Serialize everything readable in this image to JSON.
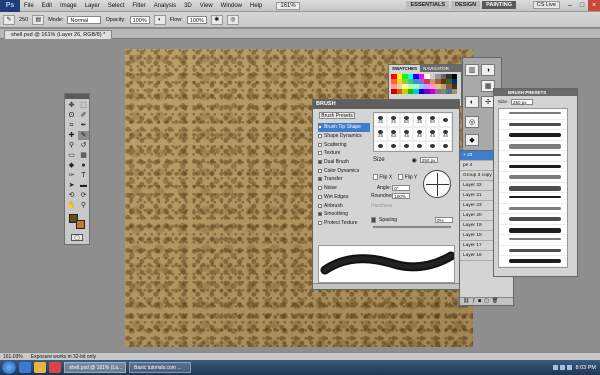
{
  "menubar": {
    "items": [
      "File",
      "Edit",
      "Image",
      "Layer",
      "Select",
      "Filter",
      "Analysis",
      "3D",
      "View",
      "Window",
      "Help"
    ],
    "zoom": "161%",
    "workspaces": [
      "ESSENTIALS",
      "DESIGN",
      "PAINTING"
    ],
    "active_workspace": "PAINTING",
    "cs_live": "CS Live"
  },
  "options": {
    "brush_size": "250",
    "mode_label": "Mode:",
    "mode_value": "Normal",
    "opacity_label": "Opacity:",
    "opacity_value": "100%",
    "flow_label": "Flow:",
    "flow_value": "100%"
  },
  "document": {
    "tab_label": "shell.psd @ 161% (Layer 26, RGB/8) *"
  },
  "brush_panel": {
    "title": "BRUSH",
    "presets_button": "Brush Presets",
    "options": [
      {
        "label": "Brush Tip Shape",
        "checked": false,
        "selected": true
      },
      {
        "label": "Shape Dynamics",
        "checked": false,
        "selected": false
      },
      {
        "label": "Scattering",
        "checked": false,
        "selected": false
      },
      {
        "label": "Texture",
        "checked": false,
        "selected": false
      },
      {
        "label": "Dual Brush",
        "checked": true,
        "selected": false
      },
      {
        "label": "Color Dynamics",
        "checked": false,
        "selected": false
      },
      {
        "label": "Transfer",
        "checked": true,
        "selected": false
      },
      {
        "label": "Noise",
        "checked": false,
        "selected": false
      },
      {
        "label": "Wet Edges",
        "checked": false,
        "selected": false
      },
      {
        "label": "Airbrush",
        "checked": false,
        "selected": false
      },
      {
        "label": "Smoothing",
        "checked": true,
        "selected": false
      },
      {
        "label": "Protect Texture",
        "checked": false,
        "selected": false
      }
    ],
    "tips": [
      "25",
      "25",
      "50",
      "25",
      "50",
      "",
      "25",
      "63",
      "45",
      "45",
      "45",
      "45",
      "",
      "",
      "",
      "",
      "",
      ""
    ],
    "size_label": "Size",
    "size_value": "250 px",
    "flip_x": "Flip X",
    "flip_y": "Flip Y",
    "angle_label": "Angle:",
    "angle_value": "0°",
    "roundness_label": "Roundness:",
    "roundness_value": "100%",
    "hardness_label": "Hardness",
    "spacing_label": "Spacing",
    "spacing_value": "0%"
  },
  "swatches": {
    "tabs": [
      "SWATCHES",
      "NAVIGATOR"
    ],
    "layers_label": "LAYERS",
    "colors": [
      "#ff0000",
      "#ffff00",
      "#00ff00",
      "#00ffff",
      "#0000ff",
      "#ff00ff",
      "#ffffff",
      "#cccccc",
      "#999999",
      "#666666",
      "#333333",
      "#000000",
      "#ff6633",
      "#ffcc33",
      "#99cc33",
      "#33cc99",
      "#3399cc",
      "#9966cc",
      "#cc3366",
      "#cc9966",
      "#996633",
      "#663300",
      "#336633",
      "#003366",
      "#ff9999",
      "#ffcc99",
      "#ffff99",
      "#ccff99",
      "#99ffcc",
      "#99ccff",
      "#cc99ff",
      "#ff99cc",
      "#e0c090",
      "#c0a070",
      "#806040",
      "#403020",
      "#cc0000",
      "#cc6600",
      "#cccc00",
      "#00cc00",
      "#00cccc",
      "#0000cc",
      "#6600cc",
      "#cc00cc",
      "#996699",
      "#669966",
      "#666699",
      "#999966"
    ]
  },
  "presets_panel": {
    "title": "BRUSH PRESETS",
    "size_label": "Size:",
    "size_value": "250 px"
  },
  "layers": {
    "rows": [
      "+ 24",
      "pe 4",
      "Group 3 copy",
      "Layer 22",
      "Layer 21",
      "Layer 23",
      "Layer 20",
      "Layer 19",
      "Layer 18",
      "Layer 17",
      "Layer 16"
    ],
    "selected_index": 0
  },
  "status": {
    "zoom": "161.03%",
    "message": "Exposure works in 32-bit only"
  },
  "taskbar": {
    "tasks": [
      "shell.psd @ 161% (La...",
      "Basic tutorials.com ..."
    ],
    "time": "8:03 PM"
  }
}
